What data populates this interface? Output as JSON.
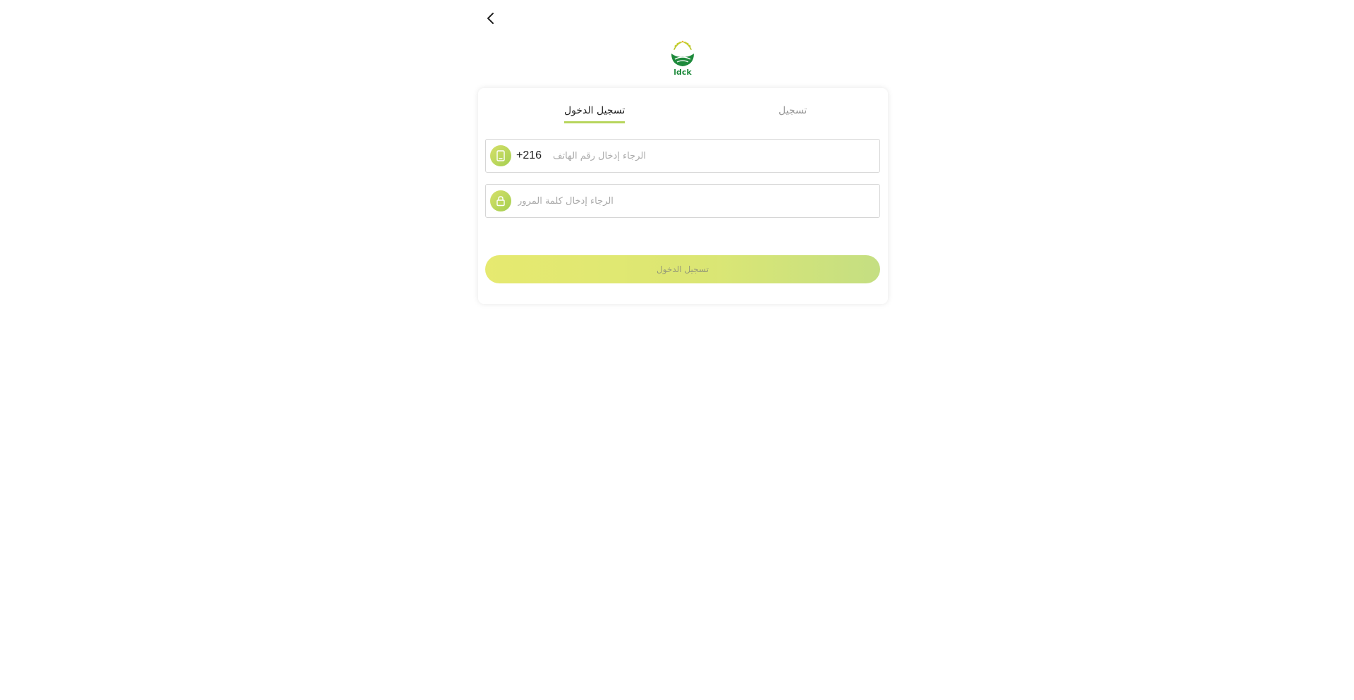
{
  "header": {
    "back_icon": "chevron-left-icon",
    "logo_text": "ldck"
  },
  "tabs": [
    {
      "label": "تسجيل الدخول",
      "active": true
    },
    {
      "label": "تسجيل",
      "active": false
    }
  ],
  "phone_field": {
    "icon": "phone-icon",
    "country_code": "+216",
    "value": "",
    "placeholder": "الرجاء إدخال رقم الهاتف"
  },
  "password_field": {
    "icon": "lock-icon",
    "value": "",
    "placeholder": "الرجاء إدخال كلمة المرور"
  },
  "submit": {
    "label": "تسجيل الدخول"
  },
  "colors": {
    "accent": "#b7d55c",
    "button_start": "#e3e760",
    "button_end": "#bedb74",
    "logo_green": "#1e8a3c"
  }
}
